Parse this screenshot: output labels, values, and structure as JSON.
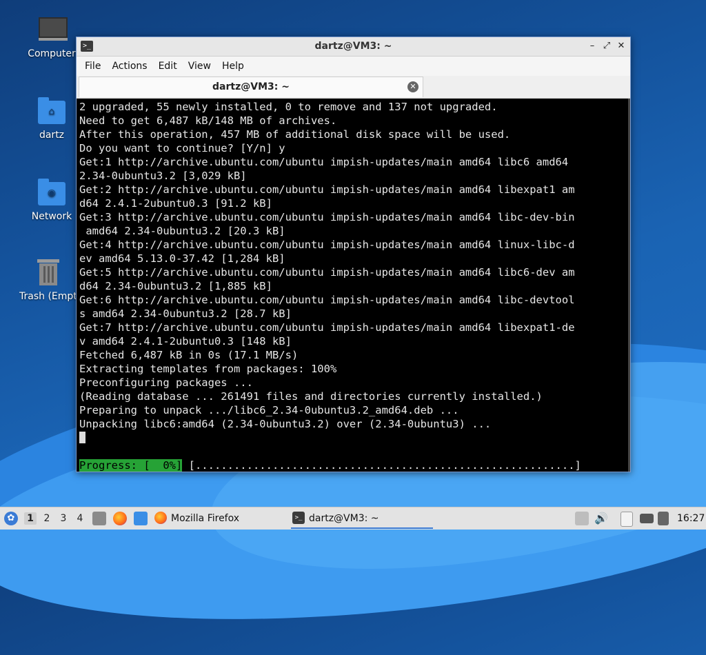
{
  "desktop": {
    "icons": [
      {
        "label": "Computer",
        "icon": "computer-icon"
      },
      {
        "label": "dartz",
        "icon": "home-folder-icon"
      },
      {
        "label": "Network",
        "icon": "network-folder-icon"
      },
      {
        "label": "Trash (Empty)",
        "icon": "trash-icon"
      }
    ]
  },
  "window": {
    "title": "dartz@VM3: ~",
    "title_icon": ">_",
    "buttons": {
      "minimize": "–",
      "maximize": "⤢",
      "close": "✕"
    },
    "menu": [
      "File",
      "Actions",
      "Edit",
      "View",
      "Help"
    ],
    "tab_label": "dartz@VM3: ~",
    "tab_close": "✕"
  },
  "terminal": {
    "lines": [
      "2 upgraded, 55 newly installed, 0 to remove and 137 not upgraded.",
      "Need to get 6,487 kB/148 MB of archives.",
      "After this operation, 457 MB of additional disk space will be used.",
      "Do you want to continue? [Y/n] y",
      "Get:1 http://archive.ubuntu.com/ubuntu impish-updates/main amd64 libc6 amd64",
      "2.34-0ubuntu3.2 [3,029 kB]",
      "Get:2 http://archive.ubuntu.com/ubuntu impish-updates/main amd64 libexpat1 am",
      "d64 2.4.1-2ubuntu0.3 [91.2 kB]",
      "Get:3 http://archive.ubuntu.com/ubuntu impish-updates/main amd64 libc-dev-bin",
      " amd64 2.34-0ubuntu3.2 [20.3 kB]",
      "Get:4 http://archive.ubuntu.com/ubuntu impish-updates/main amd64 linux-libc-d",
      "ev amd64 5.13.0-37.42 [1,284 kB]",
      "Get:5 http://archive.ubuntu.com/ubuntu impish-updates/main amd64 libc6-dev am",
      "d64 2.34-0ubuntu3.2 [1,885 kB]",
      "Get:6 http://archive.ubuntu.com/ubuntu impish-updates/main amd64 libc-devtool",
      "s amd64 2.34-0ubuntu3.2 [28.7 kB]",
      "Get:7 http://archive.ubuntu.com/ubuntu impish-updates/main amd64 libexpat1-de",
      "v amd64 2.4.1-2ubuntu0.3 [148 kB]",
      "Fetched 6,487 kB in 0s (17.1 MB/s)",
      "Extracting templates from packages: 100%",
      "Preconfiguring packages ...",
      "(Reading database ... 261491 files and directories currently installed.)",
      "Preparing to unpack .../libc6_2.34-0ubuntu3.2_amd64.deb ...",
      "Unpacking libc6:amd64 (2.34-0ubuntu3.2) over (2.34-0ubuntu3) ..."
    ],
    "progress_label": "Progress: [  0%]",
    "progress_bar": " [...........................................................]",
    "progress_color": "#26a236"
  },
  "taskbar": {
    "workspaces": [
      "1",
      "2",
      "3",
      "4"
    ],
    "active_workspace": "1",
    "tasks": [
      {
        "label": "Mozilla Firefox",
        "icon": "firefox-icon"
      },
      {
        "label": "dartz@VM3: ~",
        "icon": "terminal-icon"
      }
    ],
    "clock": "16:27"
  }
}
